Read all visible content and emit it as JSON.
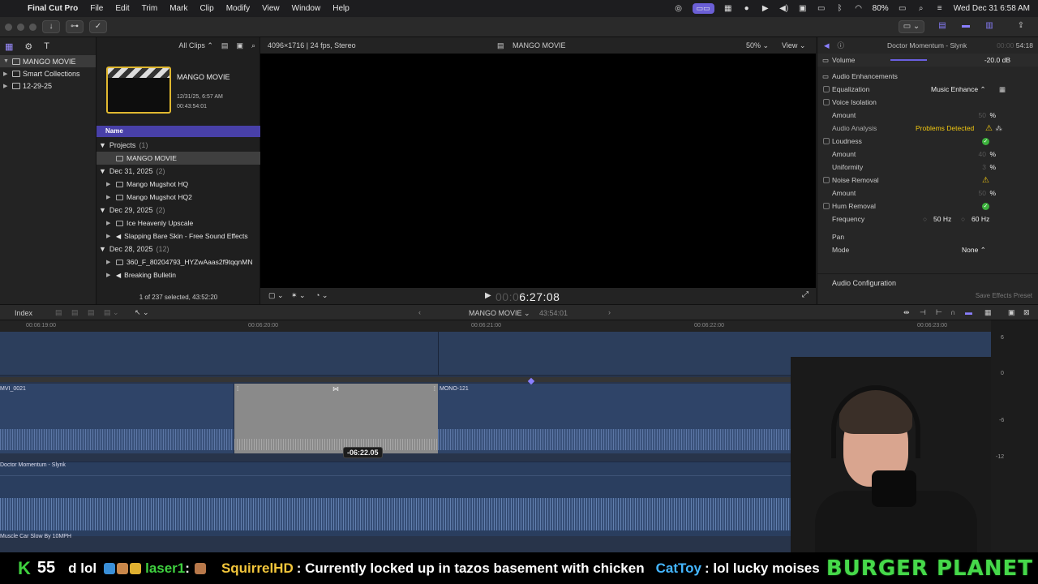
{
  "menubar": {
    "apple_icon": "apple-icon",
    "items": [
      "Final Cut Pro",
      "File",
      "Edit",
      "Trim",
      "Mark",
      "Clip",
      "Modify",
      "View",
      "Window",
      "Help"
    ],
    "battery": "80%",
    "datetime": "Wed Dec 31  6:58 AM"
  },
  "libraries": {
    "items": [
      {
        "label": "MANGO MOVIE"
      },
      {
        "label": "Smart Collections"
      },
      {
        "label": "12-29-25"
      }
    ]
  },
  "browser": {
    "filter": "All Clips",
    "featured": {
      "title": "MANGO MOVIE",
      "date": "12/31/25, 6:57 AM",
      "duration": "00:43:54:01"
    },
    "column_header": "Name",
    "groups": [
      {
        "label": "Projects",
        "count": "(1)"
      },
      {
        "label": "Dec 31, 2025",
        "count": "(2)"
      },
      {
        "label": "Dec 29, 2025",
        "count": "(2)"
      },
      {
        "label": "Dec 28, 2025",
        "count": "(12)"
      }
    ],
    "items": {
      "project": "MANGO MOVIE",
      "dec31_a": "Mango Mugshot HQ",
      "dec31_b": "Mango Mugshot HQ2",
      "dec29_a": "Ice Heavenly Upscale",
      "dec29_b": "Slapping Bare Skin - Free Sound Effects",
      "dec28_a": "360_F_80204793_HYZwAaas2f9tqqnMN",
      "dec28_b": "Breaking Bulletin"
    },
    "footer": "1 of 237 selected, 43:52:20"
  },
  "viewer": {
    "format": "4096×1716 | 24 fps, Stereo",
    "title": "MANGO MOVIE",
    "zoom": "50%",
    "view_label": "View",
    "timecode_dim": "00:0",
    "timecode": "6:27:08"
  },
  "inspector": {
    "clip_name": "Doctor Momentum - Slynk",
    "clip_duration_dim": "00:00",
    "clip_duration": "54:18",
    "volume_label": "Volume",
    "volume_value": "-20.0",
    "volume_unit": "dB",
    "enhancements_label": "Audio Enhancements",
    "equalization_label": "Equalization",
    "equalization_value": "Music Enhance",
    "voice_isolation_label": "Voice Isolation",
    "amount_label": "Amount",
    "voice_amount": "50",
    "analysis_label": "Audio Analysis",
    "analysis_value": "Problems Detected",
    "loudness_label": "Loudness",
    "loudness_amount": "40",
    "uniformity_label": "Uniformity",
    "uniformity_value": "3",
    "noise_label": "Noise Removal",
    "noise_amount": "50",
    "hum_label": "Hum Removal",
    "frequency_label": "Frequency",
    "freq_50": "50",
    "freq_60": "60",
    "hz": "Hz",
    "pct": "%",
    "pan_label": "Pan",
    "mode_label": "Mode",
    "mode_value": "None",
    "config_label": "Audio Configuration",
    "save_preset": "Save Effects Preset"
  },
  "timeline": {
    "index_label": "Index",
    "project_name": "MANGO MOVIE",
    "project_duration": "43:54:01",
    "ruler": [
      "00:06:19:00",
      "00:06:20:00",
      "00:06:21:00",
      "00:06:22:00",
      "00:06:23:00"
    ],
    "clips": {
      "clip_a": "MVI_0021",
      "clip_b": "MONO-121",
      "music": "Doctor Momentum - Slynk",
      "lower": "Muscle Car Slow By 10MPH"
    },
    "trim_tooltip": "-06:22.05",
    "meter_scale": [
      "6",
      "0",
      "-6",
      "-12"
    ]
  },
  "ticker": {
    "k": "K",
    "score": "55",
    "frag": "d lol",
    "user_laser": "laser1",
    "sep": ":",
    "user_squirrel": "SquirrelHD",
    "squirrel_msg": ": Currently locked up in tazos basement with chicken",
    "user_cattoy": "CatToy",
    "cattoy_msg": ": lol lucky moises",
    "brand": "BURGER PLANET"
  },
  "colors": {
    "accent": "#6b5fd6",
    "selection": "#4840a8",
    "warning": "#f2c811",
    "ok": "#3cb13c",
    "ticker_green": "#46d94a"
  }
}
